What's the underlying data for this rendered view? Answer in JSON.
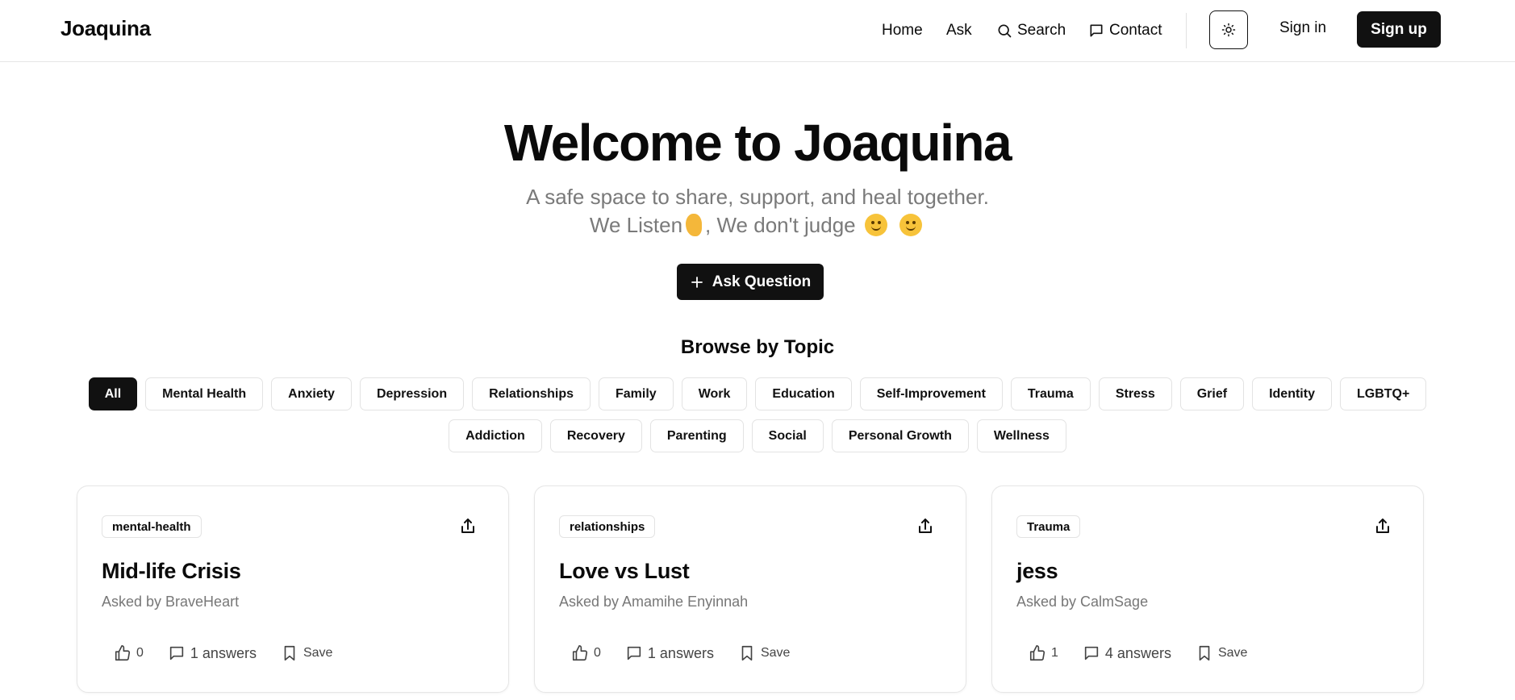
{
  "header": {
    "brand": "Joaquina",
    "nav": [
      {
        "label": "Home",
        "icon": ""
      },
      {
        "label": "Ask",
        "icon": ""
      },
      {
        "label": "Search",
        "icon": "search-icon"
      },
      {
        "label": "Contact",
        "icon": "message-icon"
      }
    ],
    "theme_icon": "sun-icon",
    "signin_label": "Sign in",
    "signup_label": "Sign up"
  },
  "hero": {
    "title": "Welcome to Joaquina",
    "subtitle": "A safe space to share, support, and heal together.",
    "tagline_a": "We Listen",
    "tagline_b": ", We don't judge",
    "ask_button": "Ask Question"
  },
  "browse": {
    "title": "Browse by Topic",
    "topics_row1": [
      "All",
      "Mental Health",
      "Anxiety",
      "Depression",
      "Relationships",
      "Family",
      "Work",
      "Education",
      "Self-Improvement",
      "Trauma",
      "Stress",
      "Grief",
      "Identity",
      "LGBTQ+"
    ],
    "topics_row2": [
      "Addiction",
      "Recovery",
      "Parenting",
      "Social",
      "Personal Growth",
      "Wellness"
    ],
    "active_topic": "All"
  },
  "cards": [
    {
      "tag": "mental-health",
      "title": "Mid-life Crisis",
      "asked_by": "Asked by BraveHeart",
      "likes": "0",
      "answers": "1 answers",
      "save": "Save"
    },
    {
      "tag": "relationships",
      "title": "Love vs Lust",
      "asked_by": "Asked by Amamihe Enyinnah",
      "likes": "0",
      "answers": "1 answers",
      "save": "Save"
    },
    {
      "tag": "Trauma",
      "title": "jess",
      "asked_by": "Asked by CalmSage",
      "likes": "1",
      "answers": "4 answers",
      "save": "Save"
    }
  ],
  "colors": {
    "primary": "#111111",
    "muted_text": "#777777",
    "border": "#e3e3e3"
  }
}
